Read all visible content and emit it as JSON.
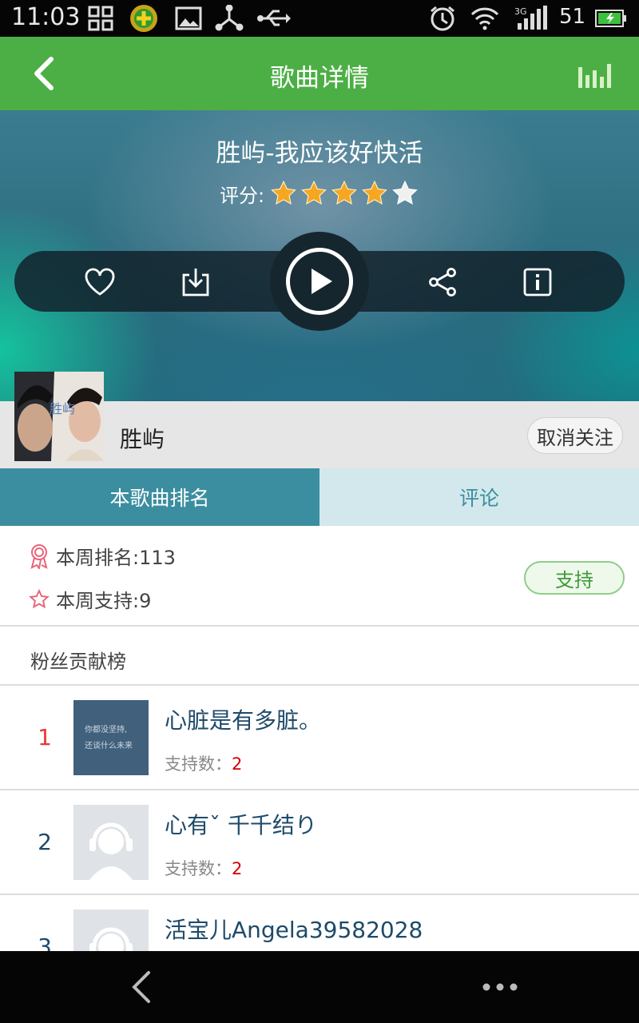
{
  "status_bar": {
    "time": "11:03",
    "battery_level": "51",
    "network": "3G",
    "icons": [
      "grid-icon",
      "app-badge-icon",
      "image-icon",
      "usb-tether-icon",
      "usb-icon",
      "alarm-icon",
      "wifi-icon",
      "signal-icon",
      "battery-icon"
    ]
  },
  "header": {
    "title": "歌曲详情",
    "back_icon": "chevron-left-icon",
    "equalizer_icon": "equalizer-icon"
  },
  "song": {
    "title": "胜屿-我应该好快活",
    "rating_label": "评分:",
    "rating_value": 4,
    "rating_max": 5,
    "star_color": "#f5a623"
  },
  "controls": {
    "favorite_icon": "heart-icon",
    "download_icon": "download-icon",
    "play_icon": "play-icon",
    "share_icon": "share-icon",
    "info_icon": "info-icon"
  },
  "artist": {
    "name": "胜屿",
    "cover_text": "胜屿",
    "unfollow_label": "取消关注"
  },
  "tabs": [
    {
      "label": "本歌曲排名",
      "active": true
    },
    {
      "label": "评论",
      "active": false
    }
  ],
  "stats": {
    "week_rank_label": "本周排名:113",
    "week_support_label": "本周支持:9",
    "support_button": "支持"
  },
  "fans": {
    "header": "粉丝贡献榜",
    "support_label": "支持数：",
    "items": [
      {
        "rank": "1",
        "name": "心脏是有多脏。",
        "support": "2",
        "avatar_text_1": "你都没坚持,",
        "avatar_text_2": "还谈什么未来"
      },
      {
        "rank": "2",
        "name": "心有ˇ 千千结り",
        "support": "2"
      },
      {
        "rank": "3",
        "name": "活宝儿Angela39582028",
        "support": ""
      }
    ]
  },
  "colors": {
    "header_green": "#4caf45",
    "tab_active": "#3b8ea0",
    "tab_inactive": "#d3e8ec",
    "rank_first": "#e53935",
    "rank_other": "#1e4a6a"
  }
}
